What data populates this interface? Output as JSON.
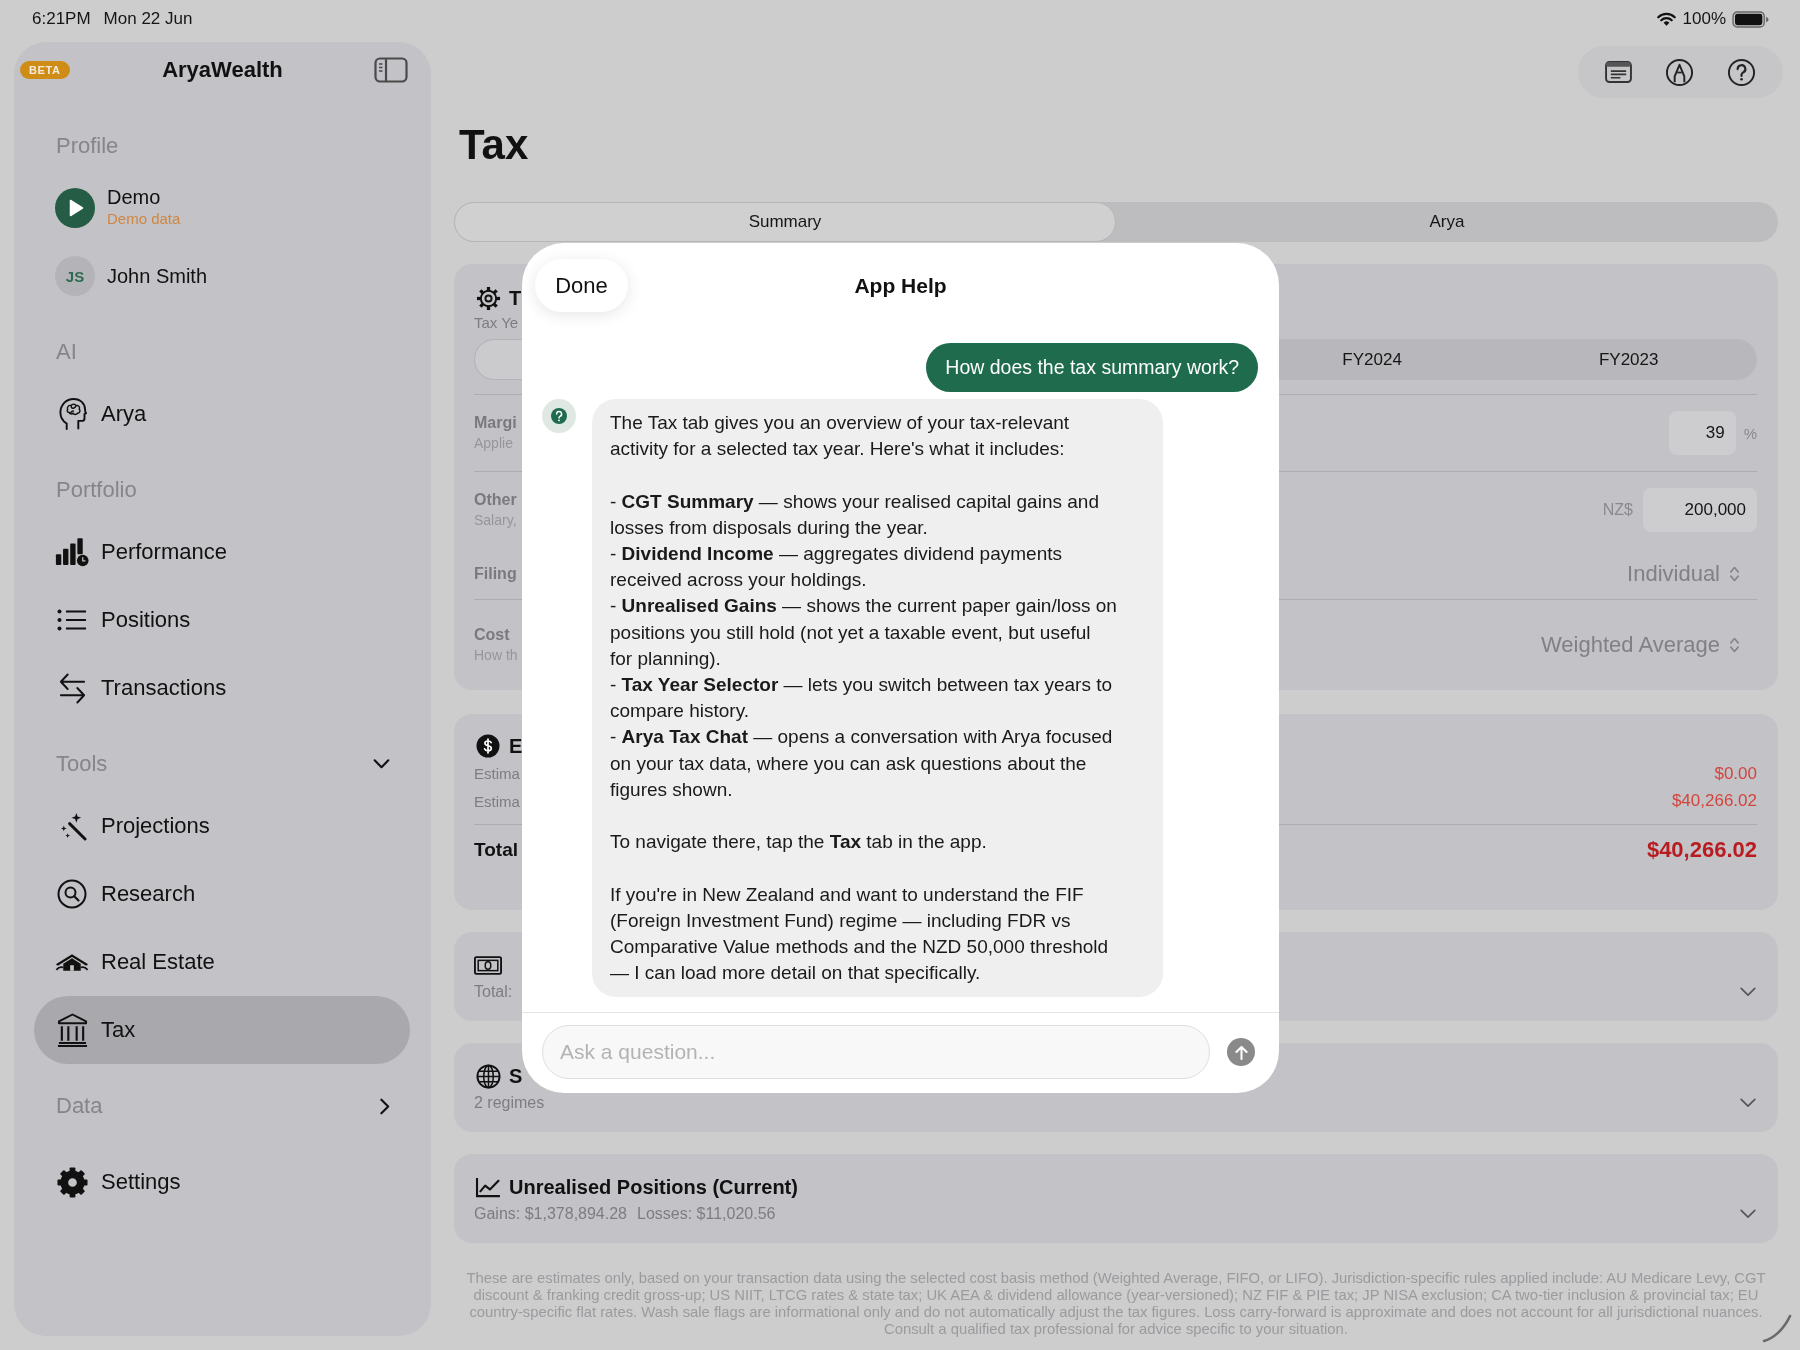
{
  "status_bar": {
    "time": "6:21PM",
    "date": "Mon 22 Jun",
    "battery": "100%"
  },
  "sidebar": {
    "badge": "BETA",
    "app_name": "AryaWealth",
    "sections": [
      {
        "title": "Profile",
        "items": [
          {
            "kind": "demo",
            "label": "Demo",
            "subtitle": "Demo data",
            "selected": false
          },
          {
            "kind": "person",
            "label": "John Smith",
            "initials": "JS",
            "selected": false
          }
        ]
      },
      {
        "title": "AI",
        "items": [
          {
            "kind": "nav",
            "label": "Arya",
            "selected": false
          }
        ]
      },
      {
        "title": "Portfolio",
        "items": [
          {
            "kind": "nav",
            "label": "Performance",
            "selected": false
          },
          {
            "kind": "nav",
            "label": "Positions",
            "selected": false
          },
          {
            "kind": "nav",
            "label": "Transactions",
            "selected": false
          }
        ]
      },
      {
        "title": "Tools",
        "expanded": true,
        "items": [
          {
            "kind": "nav",
            "label": "Projections",
            "selected": false
          },
          {
            "kind": "nav",
            "label": "Research",
            "selected": false
          },
          {
            "kind": "nav",
            "label": "Real Estate",
            "selected": false
          },
          {
            "kind": "nav",
            "label": "Tax",
            "selected": true
          }
        ]
      },
      {
        "title": "Data",
        "expanded": false
      },
      {
        "items": [
          {
            "kind": "nav",
            "label": "Settings",
            "selected": false
          }
        ]
      }
    ]
  },
  "page": {
    "title": "Tax",
    "tabs": [
      {
        "label": "Summary",
        "selected": true
      },
      {
        "label": "Arya",
        "selected": false
      }
    ],
    "settings_card": {
      "title": "T",
      "year_label": "Tax Ye",
      "year_segments": [
        {
          "selected": true
        },
        {
          "label": "FY2024",
          "selected": false
        },
        {
          "label": "FY2023",
          "selected": false
        }
      ],
      "groups": [
        {
          "rows": [
            {
              "kind": "number",
              "label": "Margi",
              "hint": "Applie",
              "value": "39",
              "unit": "%"
            }
          ]
        },
        {
          "rows": [
            {
              "kind": "amount",
              "label": "Other",
              "hint": "Salary,",
              "currency": "NZ$",
              "value": "200,000"
            },
            {
              "kind": "picker",
              "label": "Filing",
              "value": "Individual"
            }
          ]
        },
        {
          "rows": [
            {
              "kind": "picker",
              "label": "Cost",
              "hint": "How th",
              "value": "Weighted Average"
            }
          ]
        }
      ]
    },
    "estimate_card": {
      "title": "E",
      "rows": [
        {
          "label": "Estima",
          "value": "$0.00"
        },
        {
          "label": "Estima",
          "value": "$40,266.02"
        }
      ],
      "total": {
        "label": "Total",
        "value": "$40,266.02"
      }
    },
    "sections": [
      {
        "details": [
          "Total:"
        ],
        "expanded": false
      },
      {
        "title": "S",
        "details": [
          "2 regimes"
        ],
        "expanded": false
      },
      {
        "title": "Unrealised Positions (Current)",
        "details": [
          "Gains: $1,378,894.28",
          "Losses: $11,020.56"
        ],
        "expanded": false
      }
    ],
    "disclaimer": "These are estimates only, based on your transaction data using the selected cost basis method (Weighted Average, FIFO, or LIFO). Jurisdiction-specific rules applied include: AU Medicare Levy, CGT discount & franking credit gross-up; US NIIT, LTCG rates & state tax; UK AEA & dividend allowance (year-versioned); NZ FIF & PIE tax; JP NISA exclusion; CA two-tier inclusion & provincial tax; EU country-specific flat rates. Wash sale flags are informational only and do not automatically adjust the tax figures. Loss carry-forward is approximate and does not account for all jurisdictional nuances. Consult a qualified tax professional for advice specific to your situation."
  },
  "help_dialog": {
    "done": "Done",
    "title": "App Help",
    "messages": [
      {
        "kind": "question",
        "text": "How does the tax summary work?"
      },
      {
        "kind": "answer",
        "paragraphs": [
          "The Tax tab gives you an overview of your tax-relevant\nactivity for a selected tax year. Here's what it includes:",
          "- **CGT Summary** — shows your realised capital gains and\nlosses from disposals during the year.\n- **Dividend Income** — aggregates dividend payments\nreceived across your holdings.\n- **Unrealised Gains** — shows the current paper gain/loss on\npositions you still hold (not yet a taxable event, but useful\nfor planning).\n- **Tax Year Selector** — lets you switch between tax years to\ncompare history.\n- **Arya Tax Chat** — opens a conversation with Arya focused\non your tax data, where you can ask questions about the\nfigures shown.",
          "To navigate there, tap the **Tax** tab in the app.",
          "If you're in New Zealand and want to understand the FIF\n(Foreign Investment Fund) regime — including FDR vs\nComparative Value methods and the NZD 50,000 threshold\n— I can load more detail on that specifically."
        ]
      }
    ],
    "input": {
      "placeholder": "Ask a question..."
    }
  }
}
